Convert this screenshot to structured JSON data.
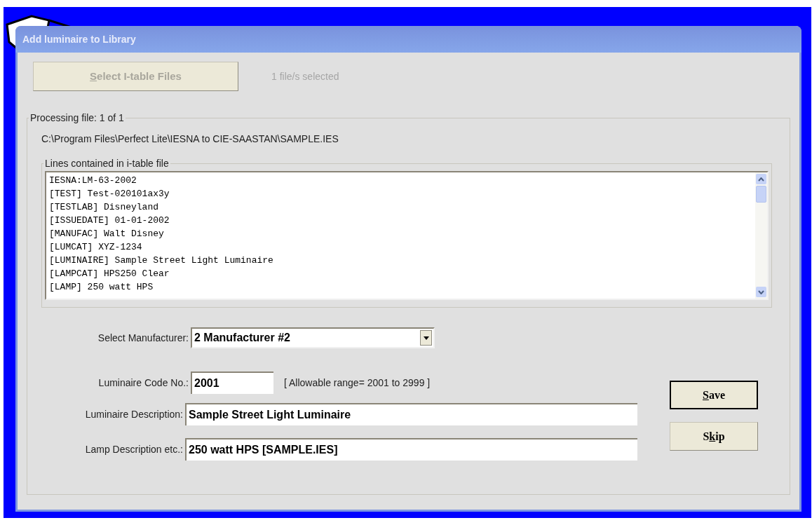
{
  "window": {
    "title": "Add luminaire to Library"
  },
  "select_button": {
    "label": [
      {
        "text": "S",
        "underlined": true
      },
      {
        "text": "elect I-table Files",
        "underlined": false
      }
    ],
    "disabled": true
  },
  "selection_status": "1 file/s selected",
  "processing_group": {
    "legend": "Processing file: 1 of 1",
    "path": "C:\\Program Files\\Perfect Lite\\IESNA to CIE-SAASTAN\\SAMPLE.IES"
  },
  "lines_group": {
    "legend": "Lines contained in i-table file",
    "lines": [
      "IESNA:LM-63-2002",
      "[TEST] Test-020101ax3y",
      "[TESTLAB] Disneyland",
      "[ISSUEDATE] 01-01-2002",
      "[MANUFAC] Walt Disney",
      "[LUMCAT] XYZ-1234",
      "[LUMINAIRE] Sample Street Light Luminaire",
      "[LAMPCAT] HPS250 Clear",
      "[LAMP] 250 watt HPS"
    ]
  },
  "manufacturer": {
    "label": "Select Manufacturer:",
    "value": "2 Manufacturer #2"
  },
  "code": {
    "label": "Luminaire Code No.:",
    "value": "2001",
    "hint": "[ Allowable range= 2001 to 2999 ]"
  },
  "luminaire_description": {
    "label": "Luminaire Description:",
    "value": "Sample Street Light Luminaire"
  },
  "lamp_description": {
    "label": "Lamp Description etc.:",
    "value": "250 watt HPS [SAMPLE.IES]"
  },
  "buttons": [
    {
      "label": [
        {
          "text": "S",
          "underlined": true
        },
        {
          "text": "ave",
          "underlined": false
        }
      ],
      "default": true
    },
    {
      "label": [
        {
          "text": "S",
          "underlined": false
        },
        {
          "text": "k",
          "underlined": true
        },
        {
          "text": "ip",
          "underlined": false
        }
      ],
      "default": false
    }
  ]
}
